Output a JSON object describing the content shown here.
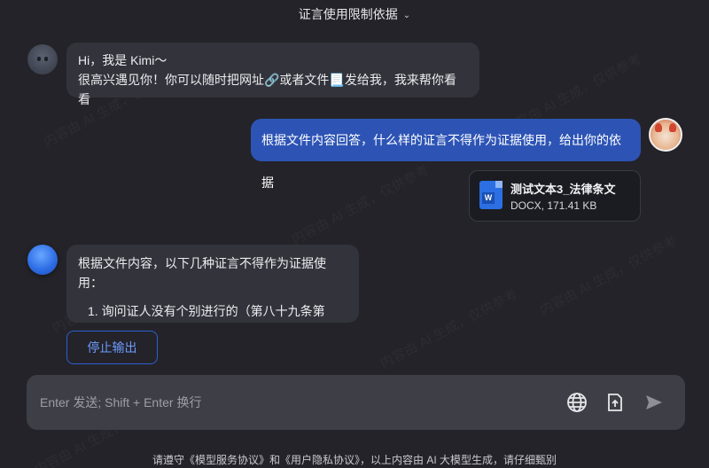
{
  "header": {
    "title": "证言使用限制依据"
  },
  "messages": {
    "greeting_line1": "Hi，我是 Kimi～",
    "greeting_line2": "很高兴遇见你！你可以随时把网址🔗或者文件📃发给我，我来帮你看看",
    "user_question": "根据文件内容回答，什么样的证言不得作为证据使用，给出你的依据",
    "file": {
      "name": "测试文本3_法律条文",
      "meta": "DOCX, 171.41 KB",
      "icon_label": "W"
    },
    "answer_intro": "根据文件内容，以下几种证言不得作为证据使用：",
    "answer_item1": "1. 询问证人没有个别进行的（第八十九条第"
  },
  "actions": {
    "stop_label": "停止输出"
  },
  "input": {
    "placeholder": "Enter 发送; Shift + Enter 换行"
  },
  "footer": {
    "notice": "请遵守《模型服务协议》和《用户隐私协议》，以上内容由 AI 大模型生成，请仔细甄别"
  },
  "watermark": "内容由 AI 生成，仅供参考",
  "colors": {
    "background": "#232329",
    "user_bubble": "#2d54b5",
    "bot_bubble": "#33343b",
    "accent": "#2f5fd0"
  }
}
